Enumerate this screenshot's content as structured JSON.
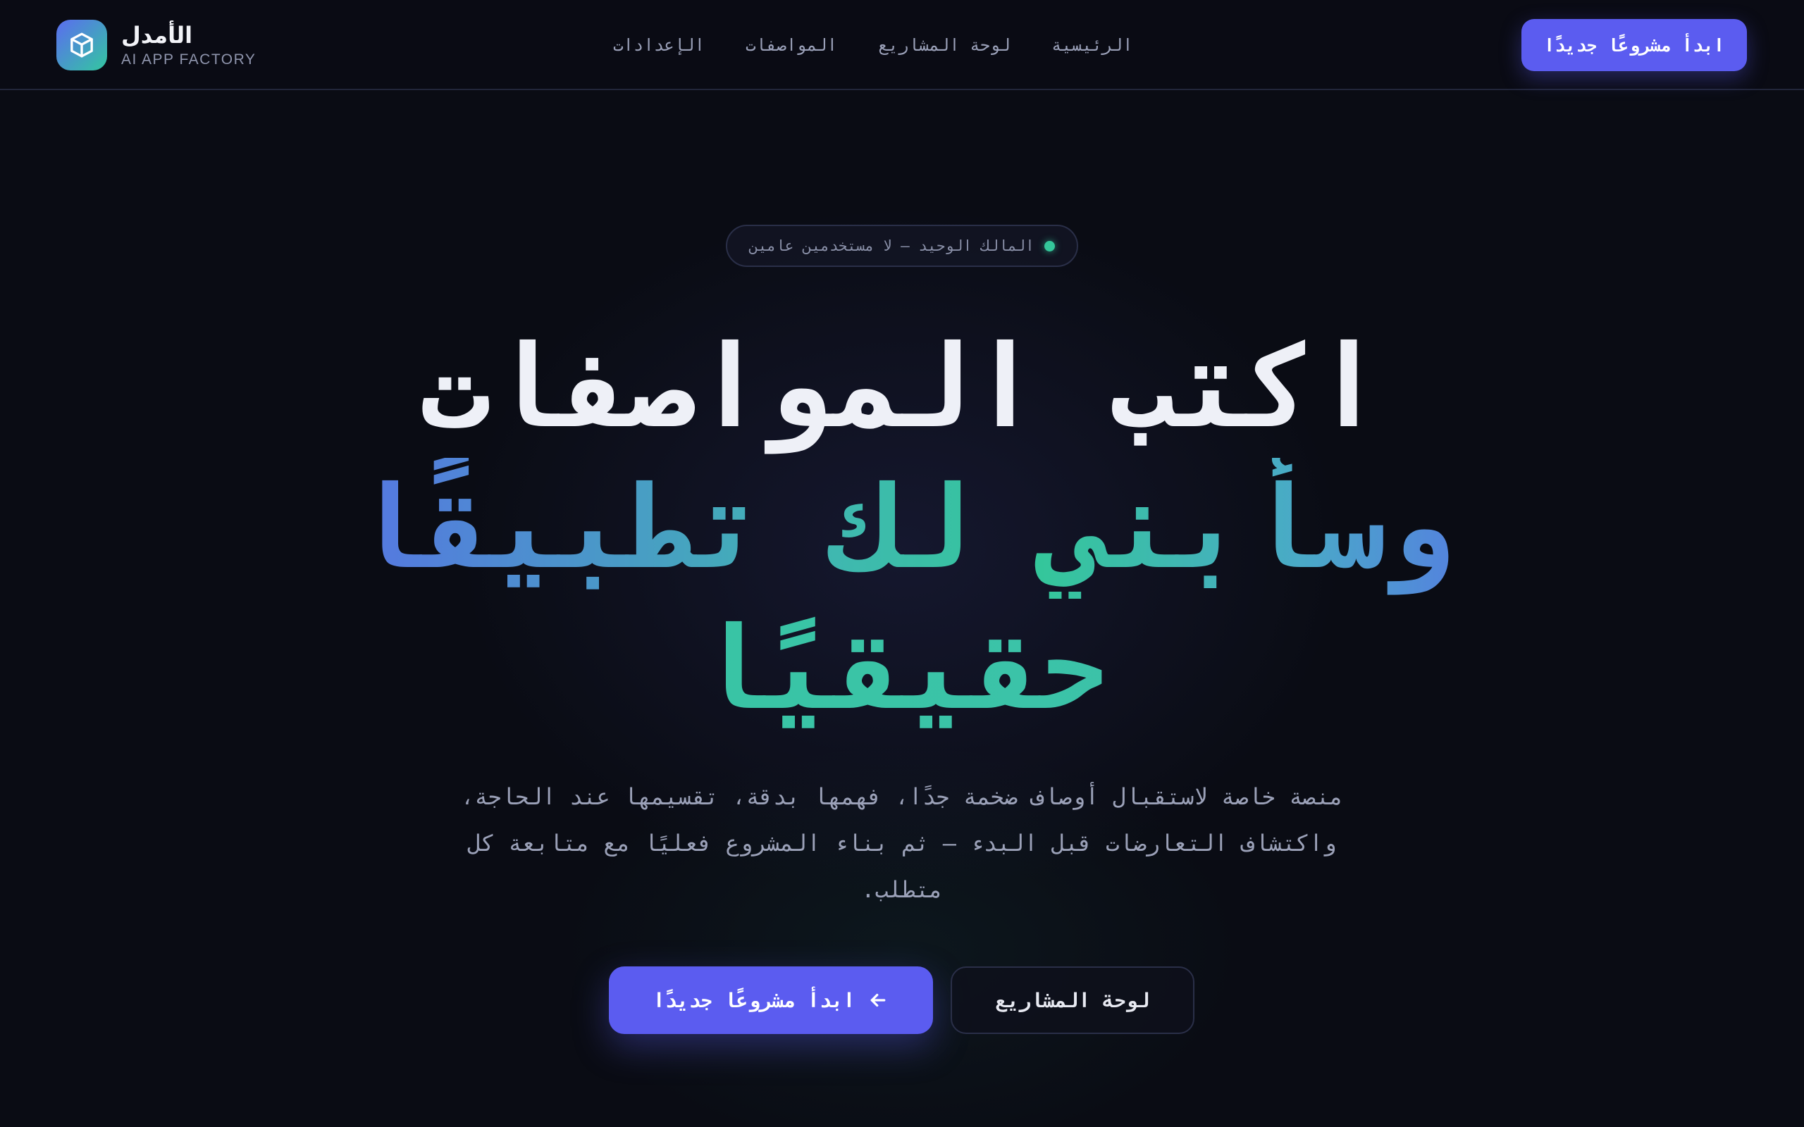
{
  "brand": {
    "name": "الأمدل",
    "tagline": "AI APP FACTORY",
    "logo_icon": "cube-icon"
  },
  "nav": {
    "items": [
      {
        "label": "الرئيسية"
      },
      {
        "label": "لوحة المشاريع"
      },
      {
        "label": "المواصفات"
      },
      {
        "label": "الإعدادات"
      }
    ],
    "cta_label": "ابدأ مشروعًا جديدًا"
  },
  "hero": {
    "badge": "المالك الوحيد — لا مستخدمين عامين",
    "headline_line1": "اكتب المواصفات",
    "headline_line2": "وسأبني لك تطبيقًا",
    "headline_line3": "حقيقيًا",
    "subtext": "منصة خاصة لاستقبال أوصاف ضخمة جدًا، فهمها بدقة، تقسيمها عند الحاجة، واكتشاف التعارضات قبل البدء — ثم بناء المشروع فعليًا مع متابعة كل متطلب.",
    "primary_cta": "ابدأ مشروعًا جديدًا",
    "secondary_cta": "لوحة المشاريع"
  },
  "colors": {
    "background": "#0a0c14",
    "accent": "#5b5cf0",
    "teal": "#34c79a"
  }
}
